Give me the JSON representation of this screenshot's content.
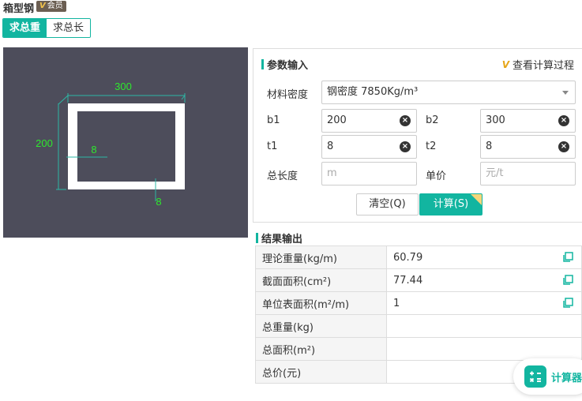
{
  "header": {
    "title": "箱型钢",
    "badge_mark": "V",
    "badge_text": "会员"
  },
  "mode_tabs": [
    {
      "label": "求总重",
      "active": true
    },
    {
      "label": "求总长",
      "active": false
    }
  ],
  "diagram": {
    "label_width": "300",
    "label_height": "200",
    "label_t1": "8",
    "label_t2": "8",
    "icons": [
      "dimension-lines"
    ]
  },
  "params": {
    "title": "参数输入",
    "view_process": "查看计算过程",
    "density_label": "材料密度",
    "density_value": "钢密度 7850Kg/m³",
    "b1_label": "b1",
    "b1_value": "200",
    "b2_label": "b2",
    "b2_value": "300",
    "t1_label": "t1",
    "t1_value": "8",
    "t2_label": "t2",
    "t2_value": "8",
    "length_label": "总长度",
    "length_placeholder": "m",
    "price_label": "单价",
    "price_placeholder": "元/t",
    "clear_button": "清空(Q)",
    "calc_button": "计算(S)"
  },
  "results": {
    "title": "结果输出",
    "rows": [
      {
        "label": "理论重量(kg/m)",
        "value": "60.79",
        "copy": true
      },
      {
        "label": "截面面积(cm²)",
        "value": "77.44",
        "copy": true
      },
      {
        "label": "单位表面积(m²/m)",
        "value": "1",
        "copy": true
      },
      {
        "label": "总重量(kg)",
        "value": "",
        "copy": false
      },
      {
        "label": "总面积(m²)",
        "value": "",
        "copy": false
      },
      {
        "label": "总价(元)",
        "value": "",
        "copy": false
      }
    ]
  },
  "float_calculator": {
    "label": "计算器"
  },
  "colors": {
    "accent": "#12b5a0",
    "diagram_bg": "#4d4d5b",
    "dimension": "#2ee82e"
  }
}
